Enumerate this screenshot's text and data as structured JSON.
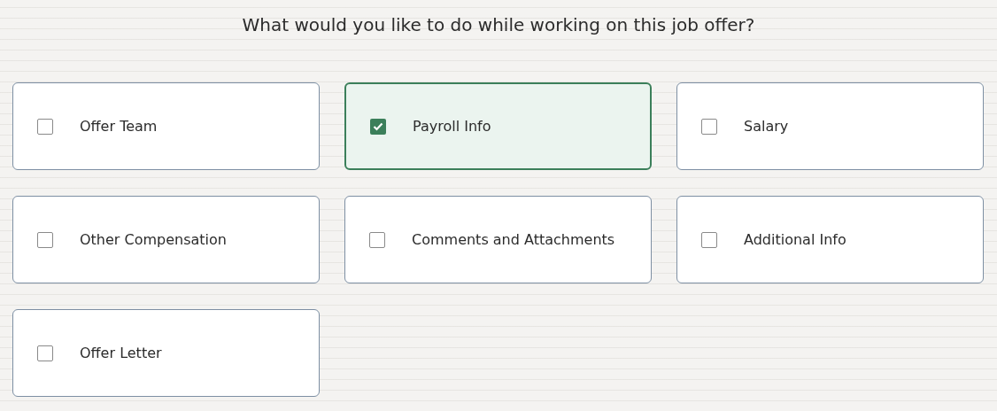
{
  "question": "What would you like to do while working on this job offer?",
  "options": [
    {
      "label": "Offer Team",
      "checked": false
    },
    {
      "label": "Payroll Info",
      "checked": true
    },
    {
      "label": "Salary",
      "checked": false
    },
    {
      "label": "Other Compensation",
      "checked": false
    },
    {
      "label": "Comments and Attachments",
      "checked": false
    },
    {
      "label": "Additional Info",
      "checked": false
    },
    {
      "label": "Offer Letter",
      "checked": false
    }
  ]
}
